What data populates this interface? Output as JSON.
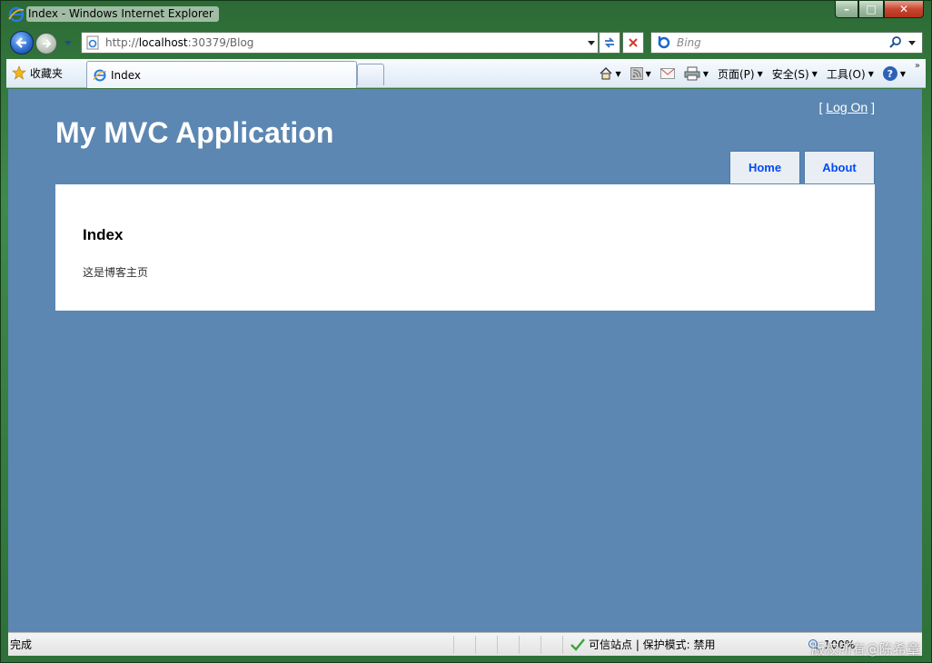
{
  "window": {
    "title": "Index - Windows Internet Explorer",
    "buttons": {
      "minimize": "–",
      "maximize": "□",
      "close": "✕"
    }
  },
  "address_bar": {
    "url_prefix": "http://",
    "url_host": "localhost",
    "url_rest": ":30379/Blog",
    "search_placeholder": "Bing"
  },
  "toolbar": {
    "favorites_label": "收藏夹",
    "tab_label": "Index",
    "page_menu": "页面(P)",
    "safety_menu": "安全(S)",
    "tools_menu": "工具(O)",
    "help_label": "?"
  },
  "page": {
    "site_title": "My MVC Application",
    "logon_open": "[",
    "logon_link": "Log On",
    "logon_close": "]",
    "menu": {
      "home": "Home",
      "about": "About"
    },
    "heading": "Index",
    "body_text": "这是博客主页"
  },
  "status": {
    "text": "完成",
    "zone": "可信站点 | 保护模式: 禁用",
    "zoom": "100%"
  },
  "watermark": "版权所有@陈希章"
}
